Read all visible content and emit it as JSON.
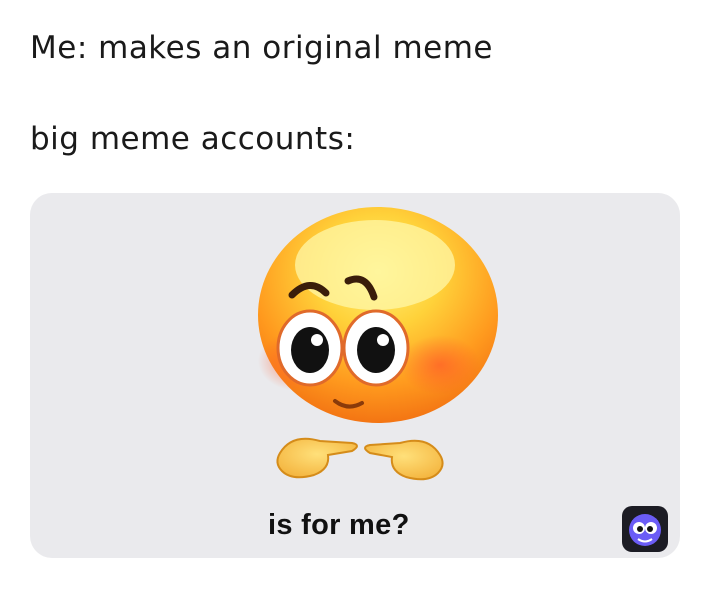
{
  "caption": {
    "line1": "Me: makes an original meme",
    "line2": "big meme accounts:"
  },
  "meme": {
    "text": "is for me?",
    "emoji": "shy-blushing-face-icon",
    "hands": "pointing-index-fingers-icon",
    "card_color": "#eaeaed",
    "face_color": "#ff9a1e"
  },
  "badge": {
    "icon": "owl-app-icon",
    "color": "#6b5cf6"
  }
}
